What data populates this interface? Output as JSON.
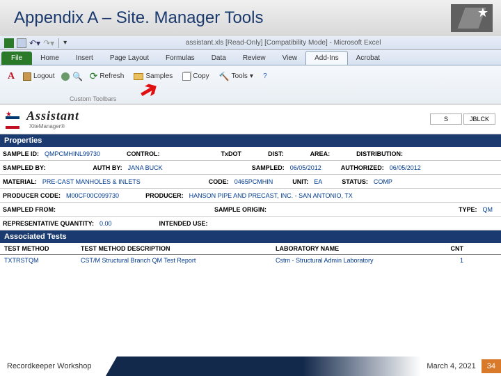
{
  "slide": {
    "title": "Appendix A – Site. Manager Tools",
    "footer_left": "Recordkeeper Workshop",
    "footer_date": "March 4, 2021",
    "footer_num": "34"
  },
  "excel": {
    "title_center": "assistant.xls  [Read-Only]  [Compatibility Mode]  -  Microsoft Excel",
    "tabs": [
      "Home",
      "Insert",
      "Page Layout",
      "Formulas",
      "Data",
      "Review",
      "View",
      "Add-Ins",
      "Acrobat"
    ],
    "file_tab": "File"
  },
  "toolbar": {
    "logout": "Logout",
    "refresh": "Refresh",
    "samples": "Samples",
    "copy": "Copy",
    "tools": "Tools",
    "custom_label": "Custom Toolbars"
  },
  "assistant": {
    "title": "Assistant",
    "sub": "XiteManager®",
    "right_cells": [
      "S",
      "JBLCK"
    ]
  },
  "sections": {
    "properties": "Properties",
    "tests": "Associated Tests"
  },
  "props": {
    "r1": {
      "sample_id_l": "SAMPLE ID:",
      "sample_id": "QMPCMHINL99730",
      "control_l": "CONTROL:",
      "txdot_l": "TxDOT",
      "dist_l": "DIST:",
      "area_l": "AREA:",
      "distribution_l": "DISTRIBUTION:"
    },
    "r2": {
      "sampled_by_l": "SAMPLED BY:",
      "auth_by_l": "AUTH BY:",
      "auth_by": "JANA BUCK",
      "sampled_l": "SAMPLED:",
      "sampled": "06/05/2012",
      "authorized_l": "AUTHORIZED:",
      "authorized": "06/05/2012"
    },
    "r3": {
      "material_l": "MATERIAL:",
      "material": "PRE-CAST MANHOLES & INLETS",
      "code_l": "CODE:",
      "code": "0465PCMHIN",
      "unit_l": "UNIT:",
      "unit": "EA",
      "status_l": "STATUS:",
      "status": "COMP"
    },
    "r4": {
      "producer_code_l": "PRODUCER CODE:",
      "producer_code": "M00CF00C099730",
      "producer_l": "PRODUCER:",
      "producer": "HANSON PIPE AND PRECAST, INC. - SAN ANTONIO, TX"
    },
    "r5": {
      "sampled_from_l": "SAMPLED FROM:",
      "sample_origin_l": "SAMPLE ORIGIN:",
      "type_l": "TYPE:",
      "type": "QM"
    },
    "r6": {
      "rep_qty_l": "REPRESENTATIVE QUANTITY:",
      "rep_qty": "0.00",
      "intended_l": "INTENDED USE:"
    }
  },
  "tests": {
    "hdr": {
      "c1": "TEST METHOD",
      "c2": "TEST METHOD DESCRIPTION",
      "c3": "LABORATORY NAME",
      "c4": "CNT"
    },
    "rows": [
      {
        "c1": "TXTRSTQM",
        "c2": "CST/M Structural Branch QM Test Report",
        "c3": "Cstm - Structural Admin Laboratory",
        "c4": "1"
      }
    ]
  }
}
